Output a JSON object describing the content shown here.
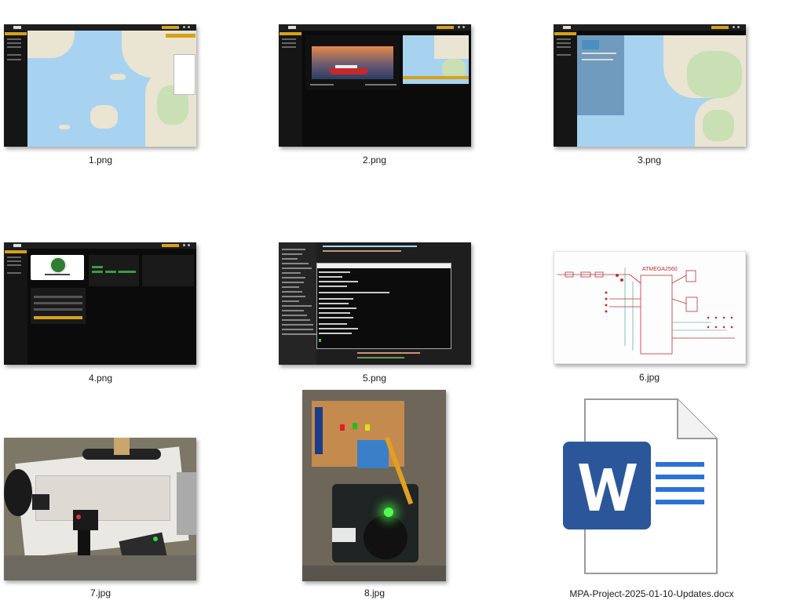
{
  "files": [
    {
      "name": "1.png",
      "kind": "screenshot-map"
    },
    {
      "name": "2.png",
      "kind": "screenshot-boat"
    },
    {
      "name": "3.png",
      "kind": "screenshot-panel-map"
    },
    {
      "name": "4.png",
      "kind": "screenshot-profile"
    },
    {
      "name": "5.png",
      "kind": "screenshot-terminal"
    },
    {
      "name": "6.jpg",
      "kind": "schematic"
    },
    {
      "name": "7.jpg",
      "kind": "photo-breadboard"
    },
    {
      "name": "8.jpg",
      "kind": "photo-pcb"
    },
    {
      "name": "MPA-Project-2025-01-10-Updates.docx",
      "kind": "word-document"
    }
  ],
  "thumb_texts": {
    "schematic_chip": "ATMEGA2560"
  },
  "colors": {
    "accent_yellow": "#d7a21a",
    "word_blue": "#2b579a",
    "word_lines": "#2b72d6",
    "map_water": "#a7d3f0",
    "map_land": "#eae4d2"
  },
  "icons": {
    "docx": "word-document-icon"
  }
}
